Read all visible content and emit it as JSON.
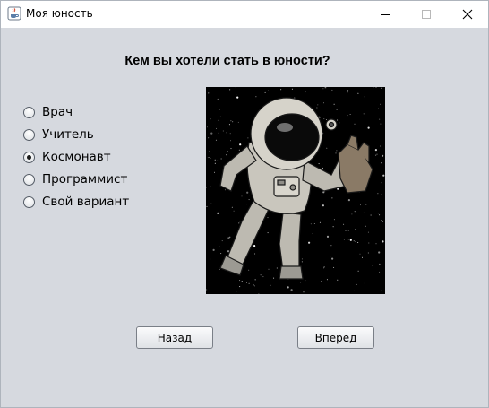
{
  "window": {
    "title": "Моя юность",
    "icon": "java-cup-icon",
    "controls": [
      "minimize-icon",
      "maximize-icon",
      "close-icon"
    ]
  },
  "question": "Кем вы хотели стать в юности?",
  "options": [
    {
      "label": "Врач",
      "selected": false
    },
    {
      "label": "Учитель",
      "selected": false
    },
    {
      "label": "Космонавт",
      "selected": true
    },
    {
      "label": "Программист",
      "selected": false
    },
    {
      "label": "Свой вариант",
      "selected": false
    }
  ],
  "image": {
    "subject": "astronaut-illustration"
  },
  "buttons": {
    "back": "Назад",
    "next": "Вперед"
  },
  "colors": {
    "background": "#d6d9df",
    "titlebar": "#ffffff",
    "image_bg": "#000000"
  }
}
